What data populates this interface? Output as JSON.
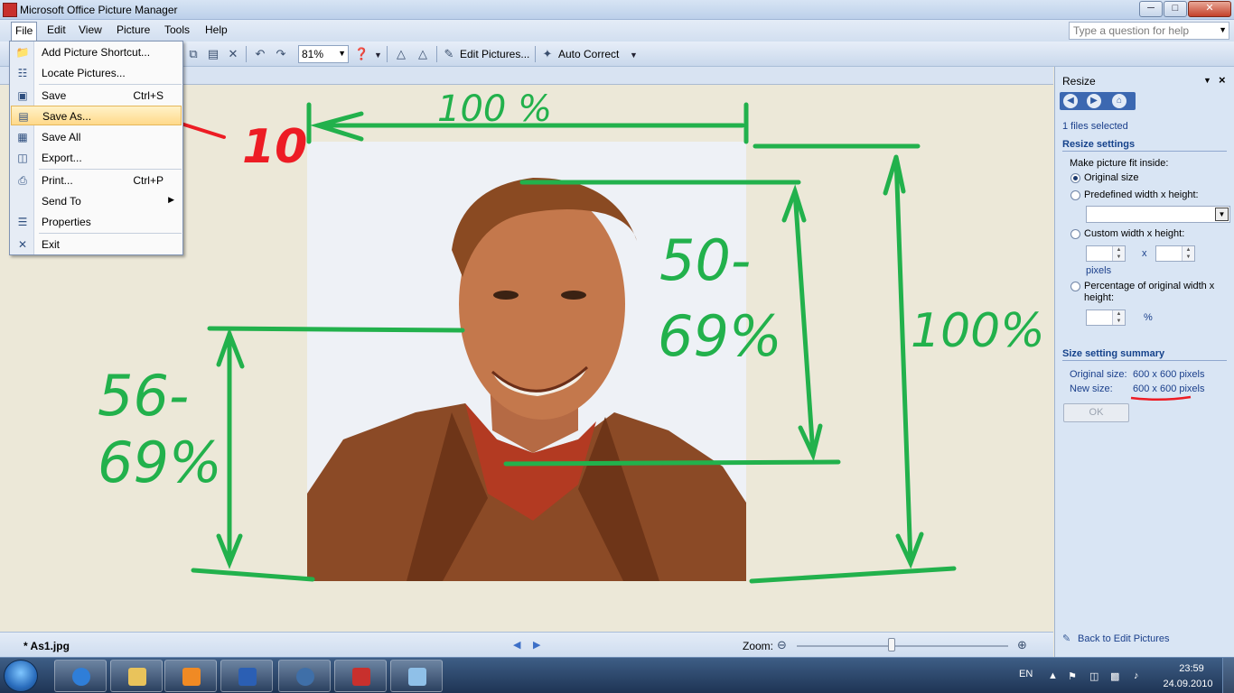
{
  "window": {
    "title": "Microsoft Office Picture Manager"
  },
  "menubar": {
    "items": [
      "File",
      "Edit",
      "View",
      "Picture",
      "Tools",
      "Help"
    ],
    "help_placeholder": "Type a question for help"
  },
  "toolbar": {
    "zoom_value": "81%",
    "edit_pictures_label": "Edit Pictures...",
    "auto_correct_label": "Auto Correct"
  },
  "file_menu": {
    "items": [
      {
        "label": "Add Picture Shortcut...",
        "shortcut": "",
        "icon": "folder-add-icon"
      },
      {
        "label": "Locate Pictures...",
        "shortcut": "",
        "icon": "locate-pictures-icon"
      },
      {
        "label": "Save",
        "shortcut": "Ctrl+S",
        "icon": "save-icon"
      },
      {
        "label": "Save As...",
        "shortcut": "",
        "icon": "save-as-icon"
      },
      {
        "label": "Save All",
        "shortcut": "",
        "icon": "save-all-icon"
      },
      {
        "label": "Export...",
        "shortcut": "",
        "icon": "export-icon"
      },
      {
        "label": "Print...",
        "shortcut": "Ctrl+P",
        "icon": "print-icon"
      },
      {
        "label": "Send To",
        "shortcut": "",
        "icon": ""
      },
      {
        "label": "Properties",
        "shortcut": "",
        "icon": "properties-icon"
      },
      {
        "label": "Exit",
        "shortcut": "",
        "icon": "close-icon"
      }
    ],
    "highlighted": "Save As..."
  },
  "annotations": {
    "step_number": "10",
    "top_width": "100 %",
    "right_height": "100%",
    "face_height": "50-69%",
    "left_height": "56-69%"
  },
  "statusbar": {
    "filename": "* As1.jpg",
    "zoom_label": "Zoom:",
    "zoom_level": 0.45
  },
  "task_pane": {
    "title": "Resize",
    "files_selected": "1 files selected",
    "resize_settings_heading": "Resize settings",
    "fit_label": "Make picture fit inside:",
    "options": {
      "original": "Original size",
      "predefined": "Predefined width x height:",
      "custom": "Custom width x height:",
      "percentage": "Percentage of original width x height:"
    },
    "selected_option": "original",
    "x_label": "x",
    "pixels_label": "pixels",
    "percent_label": "%",
    "summary_heading": "Size setting summary",
    "original_size_label": "Original size:",
    "original_size_value": "600 x 600 pixels",
    "new_size_label": "New size:",
    "new_size_value": "600 x 600 pixels",
    "ok_label": "OK",
    "back_link": "Back to Edit Pictures"
  },
  "taskbar": {
    "language": "EN",
    "time": "23:59",
    "date": "24.09.2010"
  },
  "colors": {
    "annotation_green": "#22b14c",
    "annotation_red": "#ed1c24",
    "menu_highlight": "#ffd98a"
  }
}
